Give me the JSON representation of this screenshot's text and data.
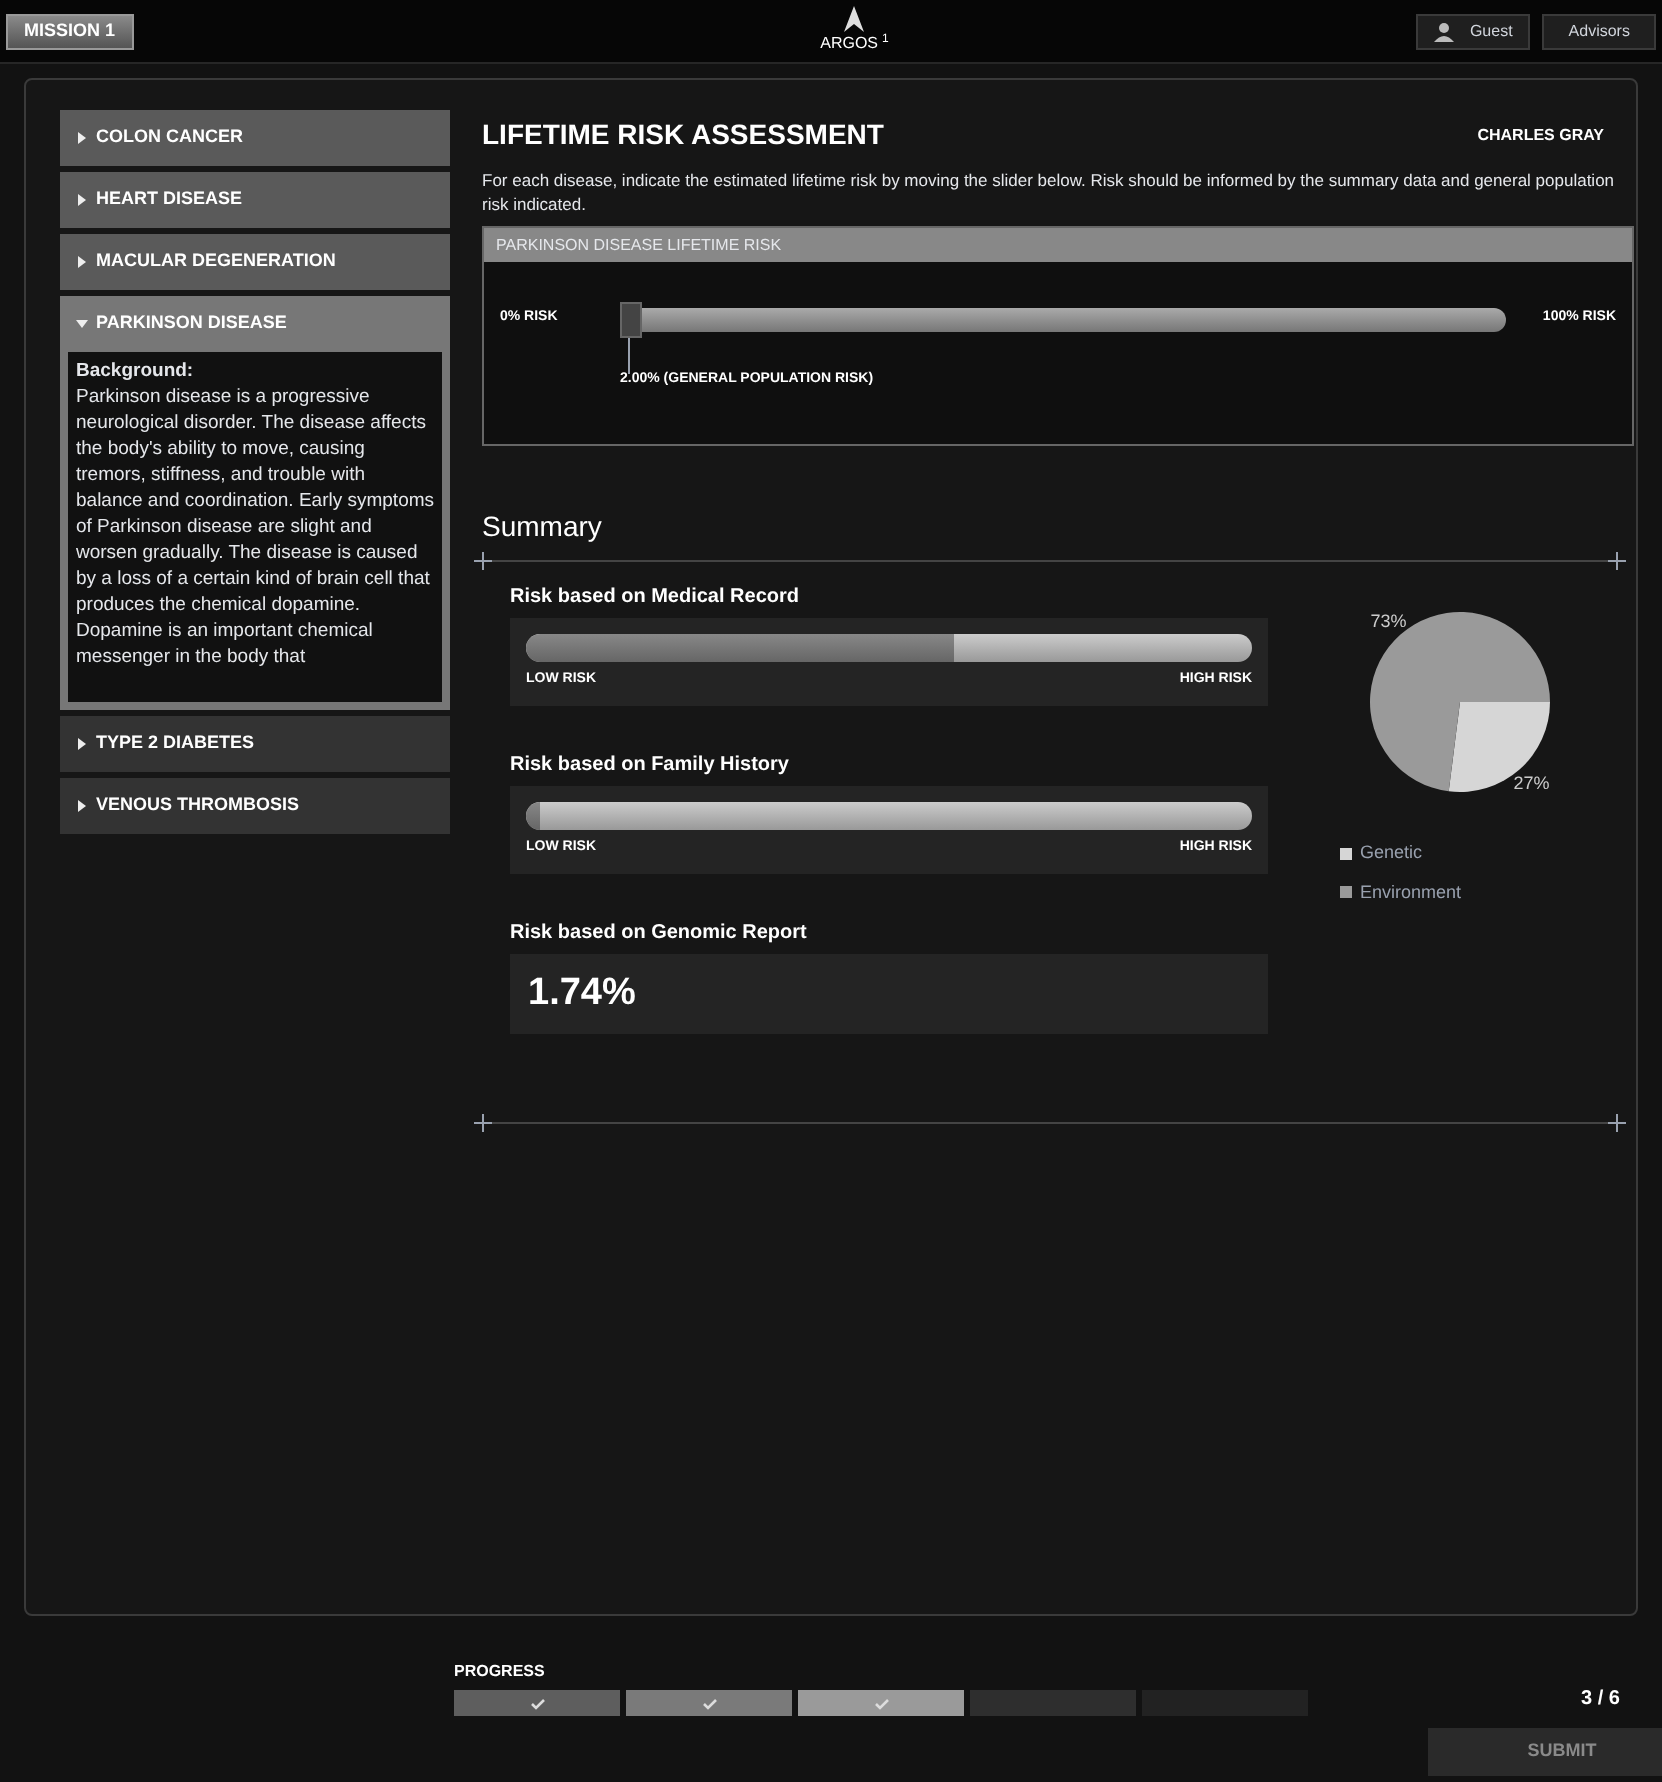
{
  "top_bar": {
    "mission": "MISSION 1",
    "logo": "ARGOS",
    "logo_sup": "1",
    "user": "Guest",
    "advisors": "Advisors"
  },
  "sidebar": {
    "items": [
      {
        "label": "COLON CANCER",
        "expanded": false
      },
      {
        "label": "HEART DISEASE",
        "expanded": false
      },
      {
        "label": "MACULAR DEGENERATION",
        "expanded": false
      },
      {
        "label": "PARKINSON DISEASE",
        "expanded": true,
        "background_title": "Background:",
        "background_text": "Parkinson disease is a progressive neurological disorder. The disease affects the body's ability to move, causing tremors, stiffness, and trouble with balance and coordination. Early symptoms of Parkinson disease are slight and worsen gradually. The disease is caused by a loss of a certain kind of brain cell that produces the chemical dopamine. Dopamine is an important chemical messenger in the body that"
      },
      {
        "label": "TYPE 2 DIABETES",
        "expanded": false
      },
      {
        "label": "VENOUS THROMBOSIS",
        "expanded": false
      }
    ]
  },
  "assessment": {
    "title": "LIFETIME RISK ASSESSMENT",
    "patient": "CHARLES GRAY",
    "instructions": "For each disease, indicate the estimated lifetime risk by moving the slider below. Risk should be informed by the summary data and general population risk indicated.",
    "slider": {
      "header": "PARKINSON DISEASE LIFETIME RISK",
      "min_label": "0% RISK",
      "max_label": "100% RISK",
      "level": 0.0,
      "population_label": "2.00% (GENERAL POPULATION RISK)"
    }
  },
  "summary": {
    "title": "Summary",
    "meters": [
      {
        "kind": "bar",
        "label": "Risk based on Medical Record",
        "level": 0.59,
        "low": "LOW RISK",
        "high": "HIGH RISK"
      },
      {
        "kind": "bar",
        "label": "Risk based on Family History",
        "level": 0.02,
        "low": "LOW RISK",
        "high": "HIGH RISK"
      },
      {
        "kind": "value",
        "label": "Risk based on Genomic Report",
        "value": "1.74%"
      }
    ],
    "chart_data": {
      "type": "pie",
      "categories": [
        "Genetic",
        "Environment"
      ],
      "values": [
        27,
        73
      ],
      "colors": [
        "#d6d6d6",
        "#9a9a9a"
      ],
      "data_labels": true,
      "value_labels": [
        "27%",
        "73%"
      ],
      "legend": "bottom"
    }
  },
  "footer": {
    "progress_label": "PROGRESS",
    "steps": [
      {
        "done": true,
        "color": "#5e5e5e"
      },
      {
        "done": true,
        "color": "#7a7a7a"
      },
      {
        "done": true,
        "color": "#9a9a9a"
      },
      {
        "done": false,
        "color": "#2e2e2e"
      },
      {
        "done": false,
        "color": "#222222"
      }
    ],
    "count": "3 / 6",
    "submit": {
      "label": "SUBMIT",
      "disabled": true
    }
  }
}
